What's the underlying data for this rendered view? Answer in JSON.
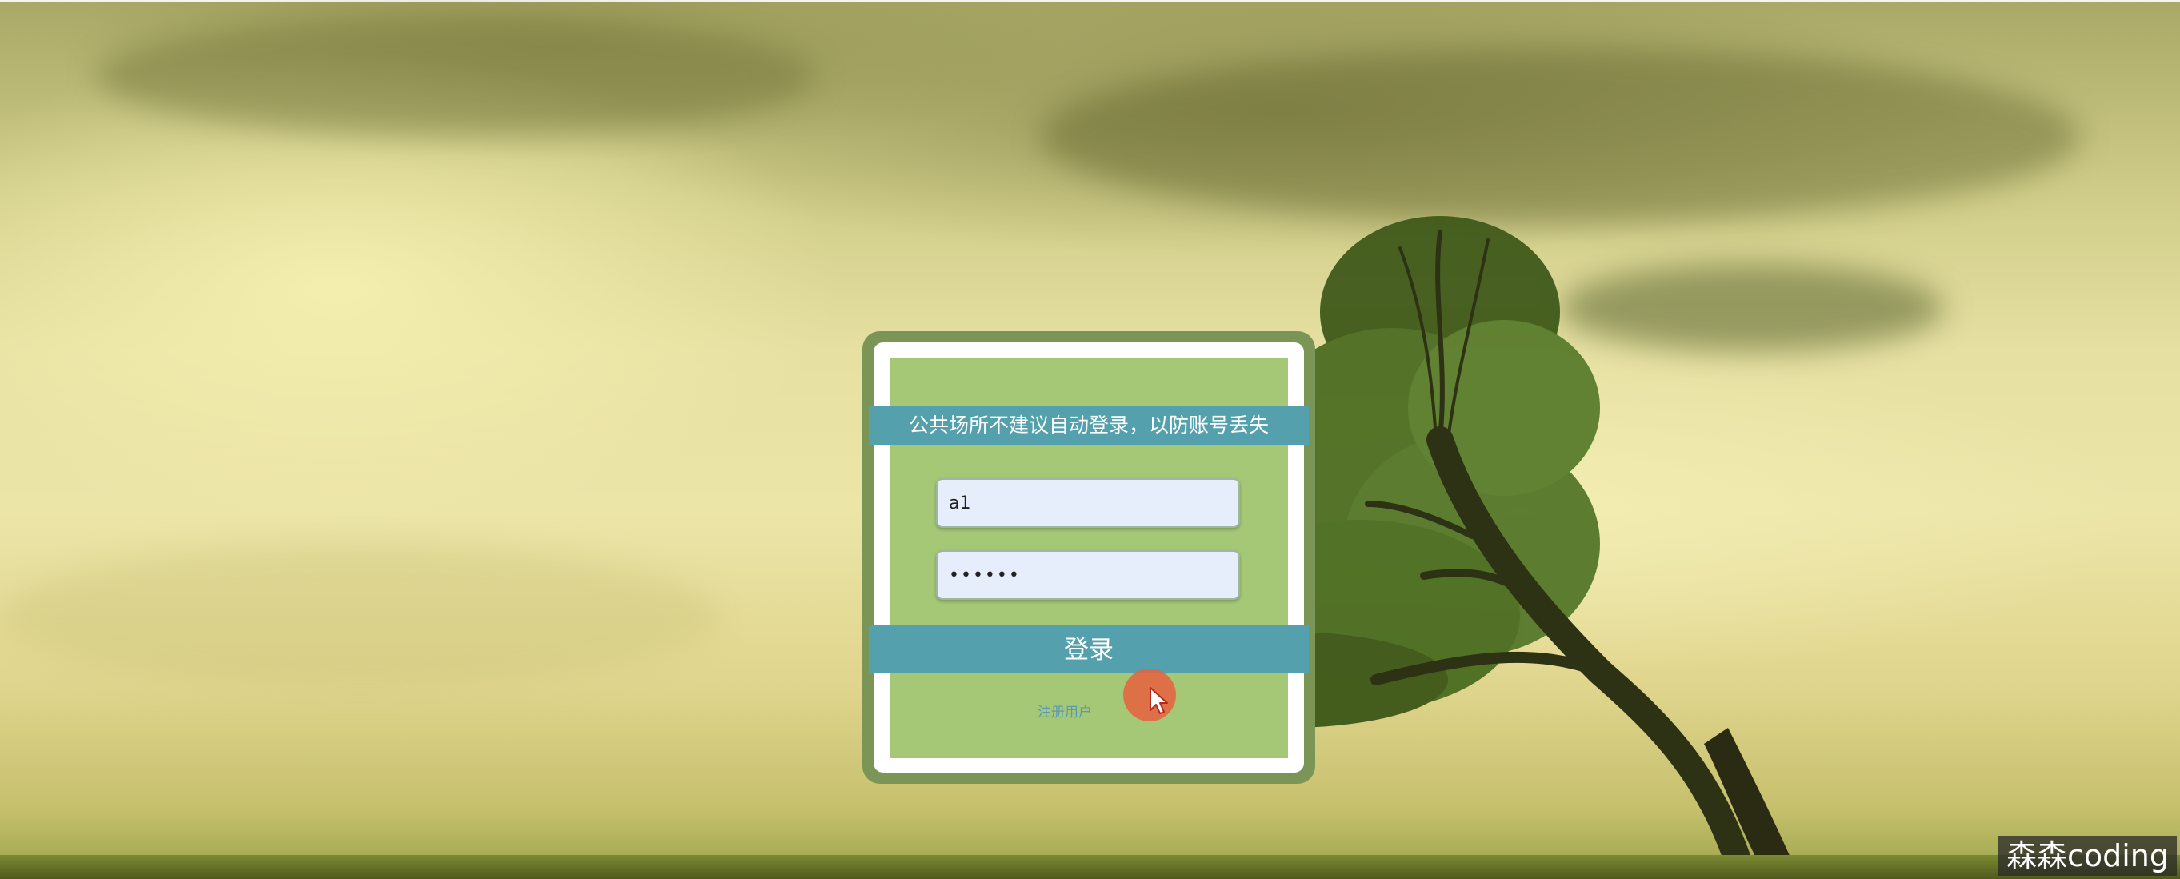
{
  "login": {
    "notice": "公共场所不建议自动登录，以防账号丢失",
    "username_value": "a1",
    "password_value": "••••••",
    "login_label": "登录",
    "register_label": "注册用户"
  },
  "watermark": "森森coding",
  "colors": {
    "card_border": "#7a9556",
    "panel_green": "#a5c876",
    "accent_teal": "#54a0ad",
    "input_bg": "#e6eefb",
    "cursor_halo": "#e86040"
  },
  "icons": {
    "cursor": "mouse-pointer-icon"
  }
}
